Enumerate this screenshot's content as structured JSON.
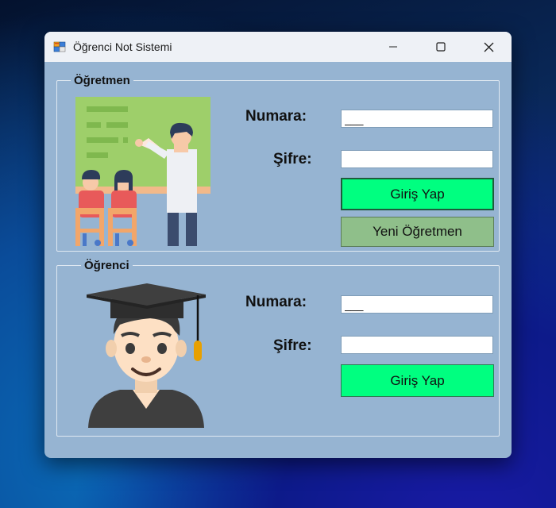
{
  "window": {
    "title": "Öğrenci Not Sistemi",
    "icon": "app-form-icon"
  },
  "titlebar_buttons": [
    "minimize-icon",
    "maximize-icon",
    "close-icon"
  ],
  "teacher": {
    "group_title": "Öğretmen",
    "number_label": "Numara:",
    "number_value": "___",
    "password_label": "Şifre:",
    "password_value": "",
    "login_button": "Giriş Yap",
    "new_button": "Yeni Öğretmen",
    "illustration": "teacher-classroom-icon"
  },
  "student": {
    "group_title": "Öğrenci",
    "number_label": "Numara:",
    "number_value": "___",
    "password_label": "Şifre:",
    "password_value": "",
    "login_button": "Giriş Yap",
    "illustration": "graduate-student-icon"
  },
  "colors": {
    "window_bg": "#96b4d2",
    "login_button": "#00ff80",
    "new_button": "#8fbf8a"
  }
}
